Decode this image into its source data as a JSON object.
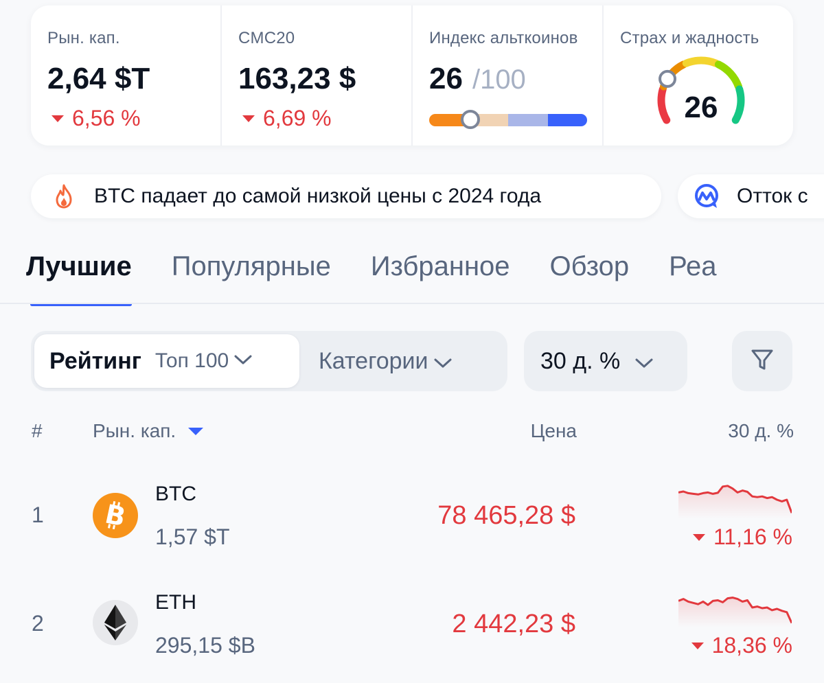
{
  "stats": {
    "market_cap": {
      "label": "Рын. кап.",
      "value": "2,64 $T",
      "change": "6,56 %"
    },
    "cmc20": {
      "label": "CMC20",
      "value": "163,23 $",
      "change": "6,69 %"
    },
    "altcoin_index": {
      "label": "Индекс альткоинов",
      "value": "26",
      "max": "/100",
      "level": 0.26
    },
    "fear_greed": {
      "label": "Страх и жадность",
      "value": "26",
      "level": 0.26
    }
  },
  "news": [
    {
      "text": "BTC падает до самой низкой цены с 2024 года",
      "icon": "fire-icon"
    },
    {
      "text": "Отток с",
      "icon": "cmc-ai-icon"
    }
  ],
  "tabs": [
    "Лучшие",
    "Популярные",
    "Избранное",
    "Обзор",
    "Реа"
  ],
  "filters": {
    "ranking_label": "Рейтинг",
    "ranking_value": "Топ 100",
    "categories_label": "Категории",
    "period_label": "30 д. %"
  },
  "table": {
    "headers": {
      "rank": "#",
      "market_cap": "Рын. кап.",
      "price": "Цена",
      "change": "30 д. %"
    },
    "rows": [
      {
        "rank": "1",
        "symbol": "BTC",
        "market_cap": "1,57 $T",
        "price": "78 465,28 $",
        "change": "11,16 %",
        "icon": "bitcoin-icon",
        "color": "#f7931a",
        "sparkline": [
          0.72,
          0.75,
          0.7,
          0.68,
          0.66,
          0.7,
          0.72,
          0.68,
          0.71,
          0.9,
          0.92,
          0.84,
          0.72,
          0.78,
          0.74,
          0.6,
          0.58,
          0.6,
          0.55,
          0.58,
          0.5,
          0.45,
          0.5,
          0.1
        ]
      },
      {
        "rank": "2",
        "symbol": "ETH",
        "market_cap": "295,15 $B",
        "price": "2 442,23 $",
        "change": "18,36 %",
        "icon": "ethereum-icon",
        "color": "#3c3c3d",
        "sparkline": [
          0.72,
          0.78,
          0.7,
          0.66,
          0.62,
          0.7,
          0.6,
          0.72,
          0.74,
          0.68,
          0.8,
          0.82,
          0.78,
          0.7,
          0.74,
          0.52,
          0.55,
          0.5,
          0.52,
          0.44,
          0.48,
          0.42,
          0.38,
          0.05
        ]
      }
    ]
  },
  "colors": {
    "negative": "#e2393e",
    "accent": "#3861fb",
    "alt_bar": [
      "#f68819",
      "#f1d3b4",
      "#a9b6e8",
      "#3861fb"
    ],
    "gauge": [
      "#ea3943",
      "#ea8c00",
      "#f3d42f",
      "#93d900",
      "#16c784"
    ]
  }
}
